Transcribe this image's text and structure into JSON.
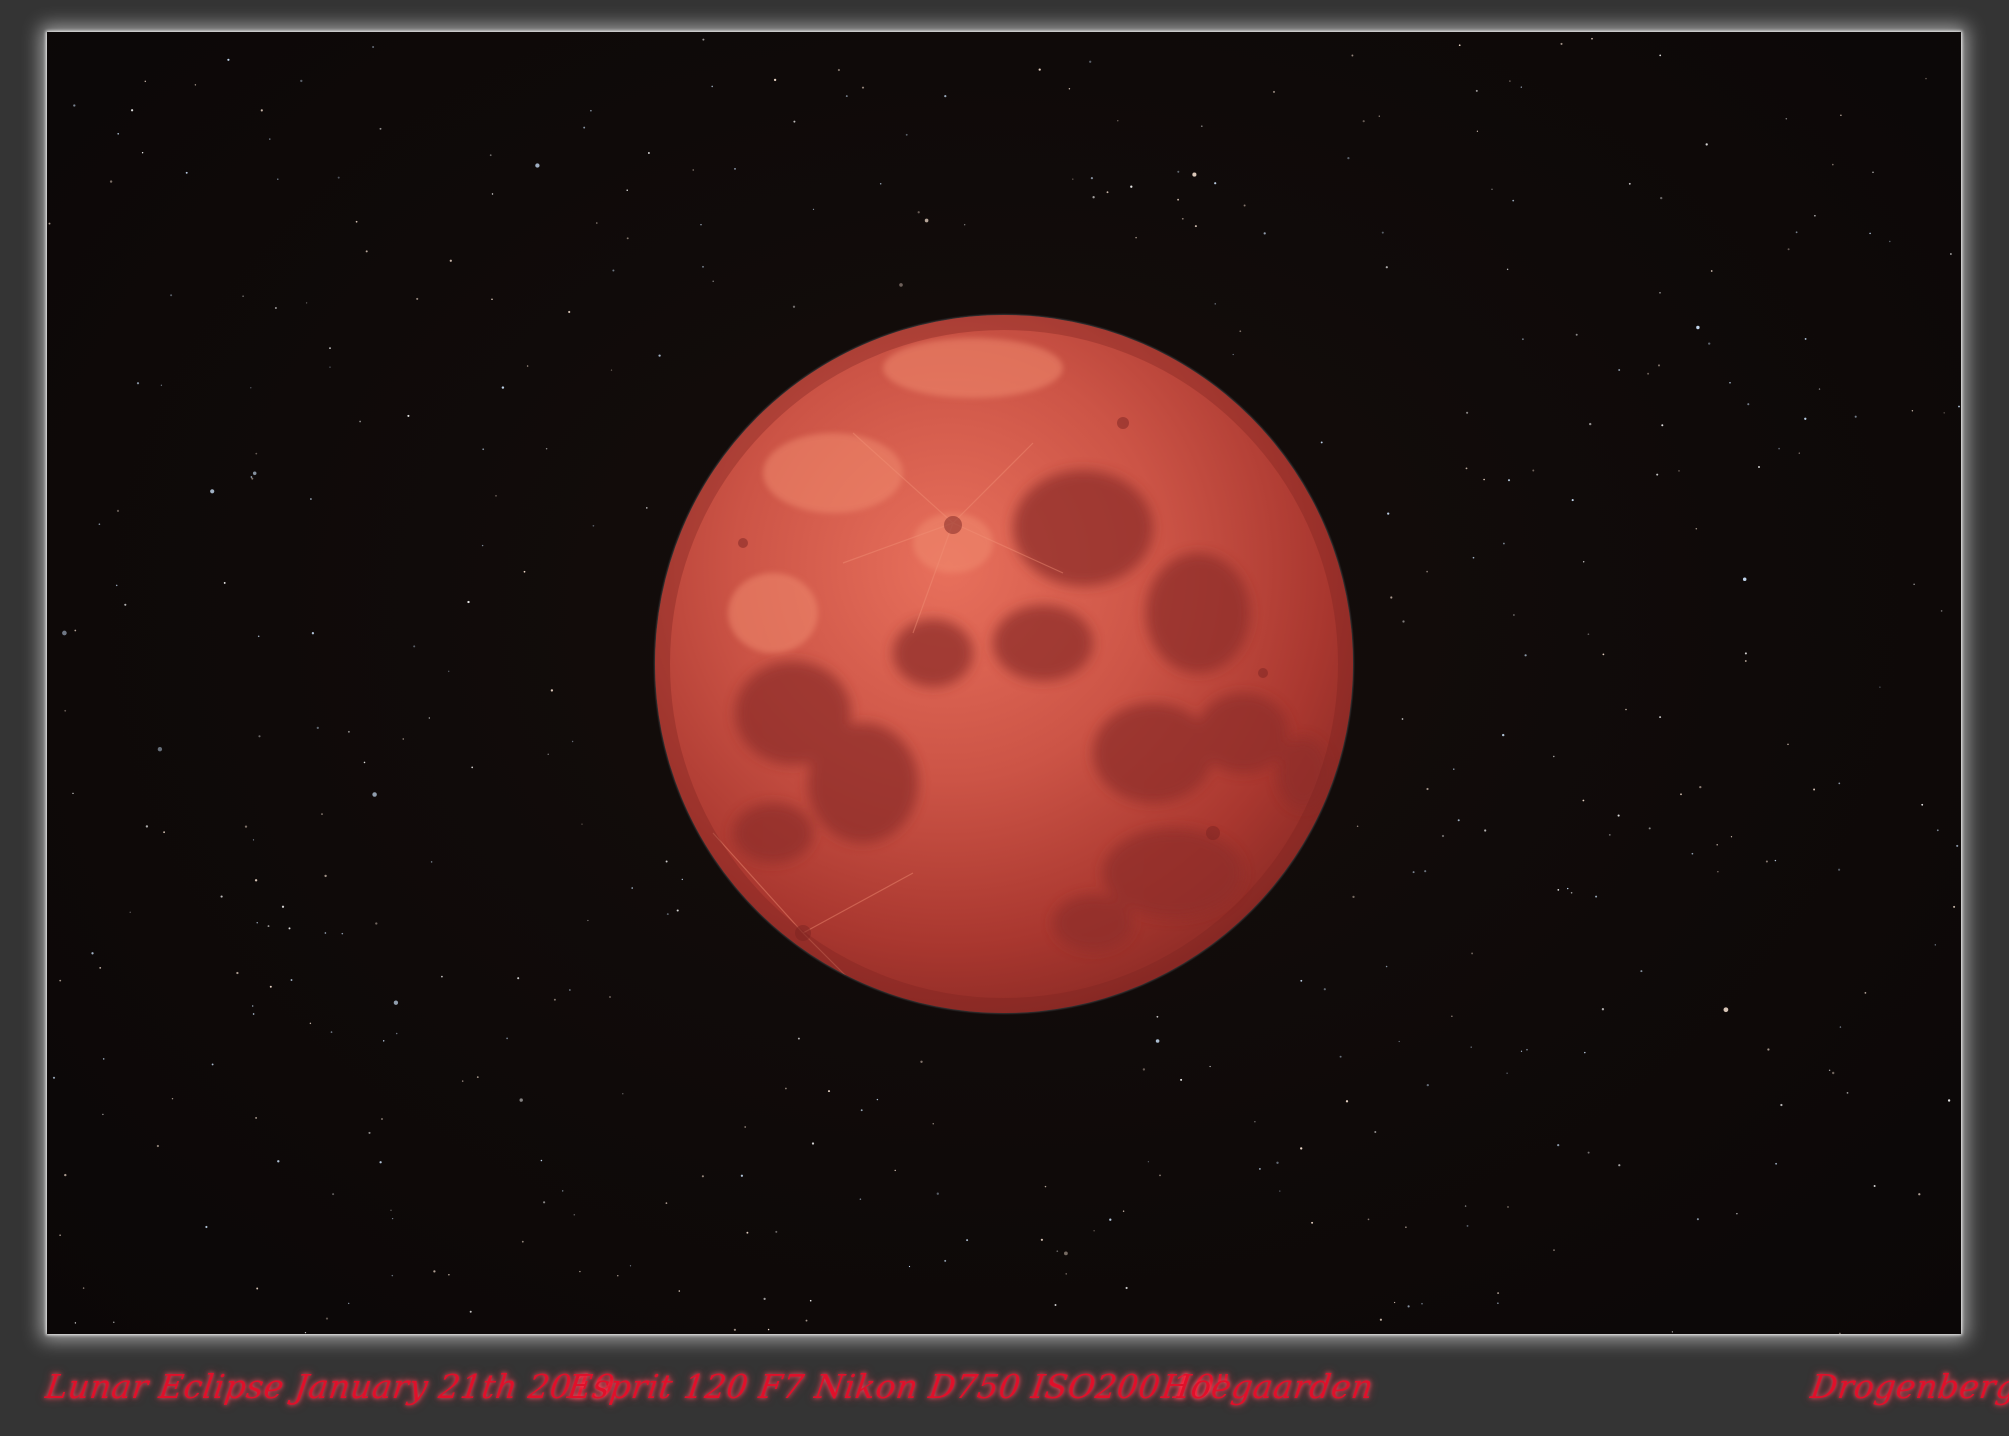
{
  "photo": {
    "subject": "lunar-eclipse-photograph",
    "icon": "moon-icon"
  },
  "caption": {
    "title": "Lunar Eclipse January 21th 2019",
    "equipment": "Esprit 120 F7 Nikon D750  ISO200 10\"",
    "location": "Hoegaarden",
    "author": "Drogenberg"
  },
  "colors": {
    "caption_text": "#e0102a",
    "frame_background": "#343434",
    "sky": "#100b0a",
    "moon_base": "#b8423a",
    "moon_highlight": "#e56a55"
  }
}
